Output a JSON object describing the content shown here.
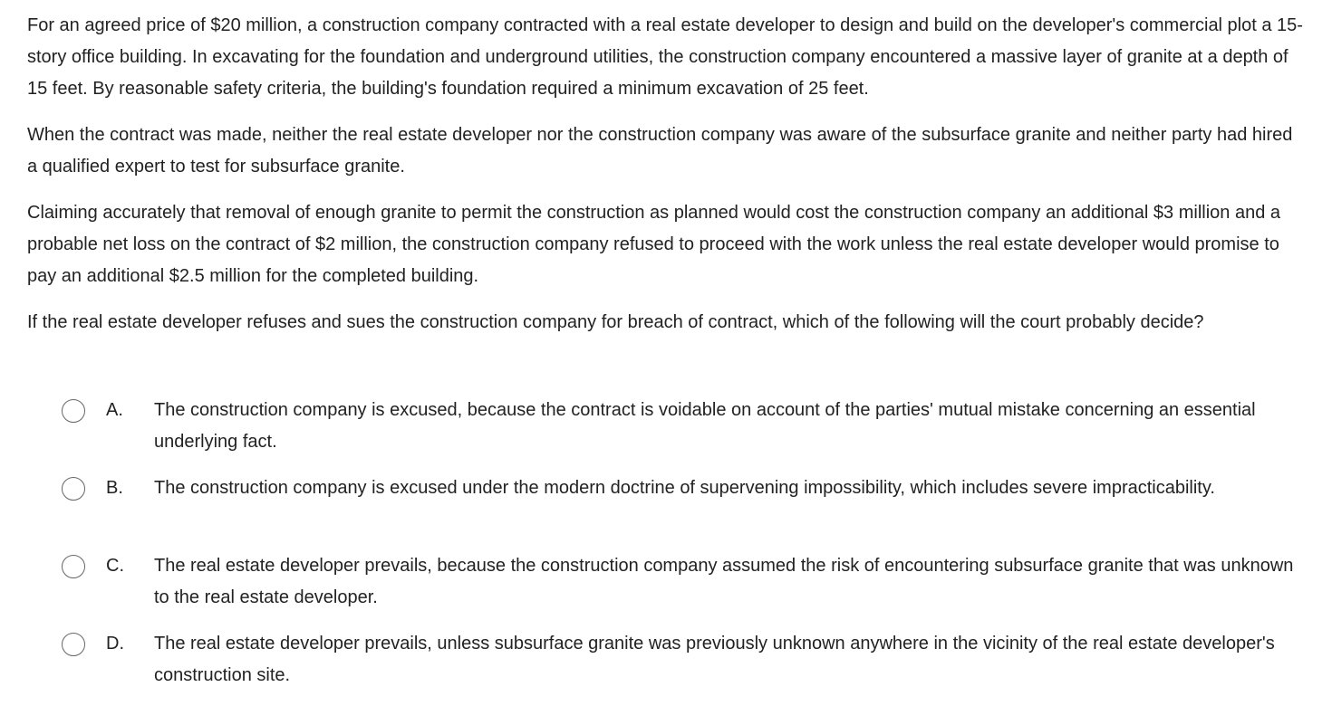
{
  "question": {
    "paragraphs": [
      "For an agreed price of $20 million, a construction company contracted with a real estate developer to design and build on the developer's commercial plot a 15-story office building.  In excavating for the foundation and underground utilities, the construction company encountered a massive layer of granite at a depth of 15 feet.  By reasonable safety criteria, the building's foundation required a minimum excavation of 25 feet.",
      "When the contract was made, neither the real estate developer nor the construction company was aware of the subsurface granite and neither party had hired a qualified expert to test for subsurface granite.",
      "Claiming accurately that removal of enough granite to permit the construction as planned would cost the construction company an additional $3 million and a probable net loss on the contract of $2 million, the construction company refused to proceed with the work unless the real estate developer would promise to pay an additional $2.5 million for the completed building.",
      "If the real estate developer refuses and sues the construction company for breach of contract, which of the following will the court probably decide?"
    ]
  },
  "options": [
    {
      "letter": "A.",
      "text": "The construction company is excused, because the contract is voidable on account of the parties' mutual mistake concerning an essential underlying fact.",
      "selected": false
    },
    {
      "letter": "B.",
      "text": "The construction company is excused under the modern doctrine of supervening impossibility, which includes severe impracticability.",
      "selected": false
    },
    {
      "letter": "C.",
      "text": "The real estate developer prevails, because the construction company assumed the risk of encountering subsurface granite that was unknown to the real estate developer.",
      "selected": false
    },
    {
      "letter": "D.",
      "text": "The real estate developer prevails, unless subsurface granite was previously unknown anywhere in the vicinity of the real estate developer's construction site.",
      "selected": false
    }
  ],
  "colors": {
    "text": "#222222",
    "radio_border": "#666666",
    "background": "#ffffff"
  }
}
